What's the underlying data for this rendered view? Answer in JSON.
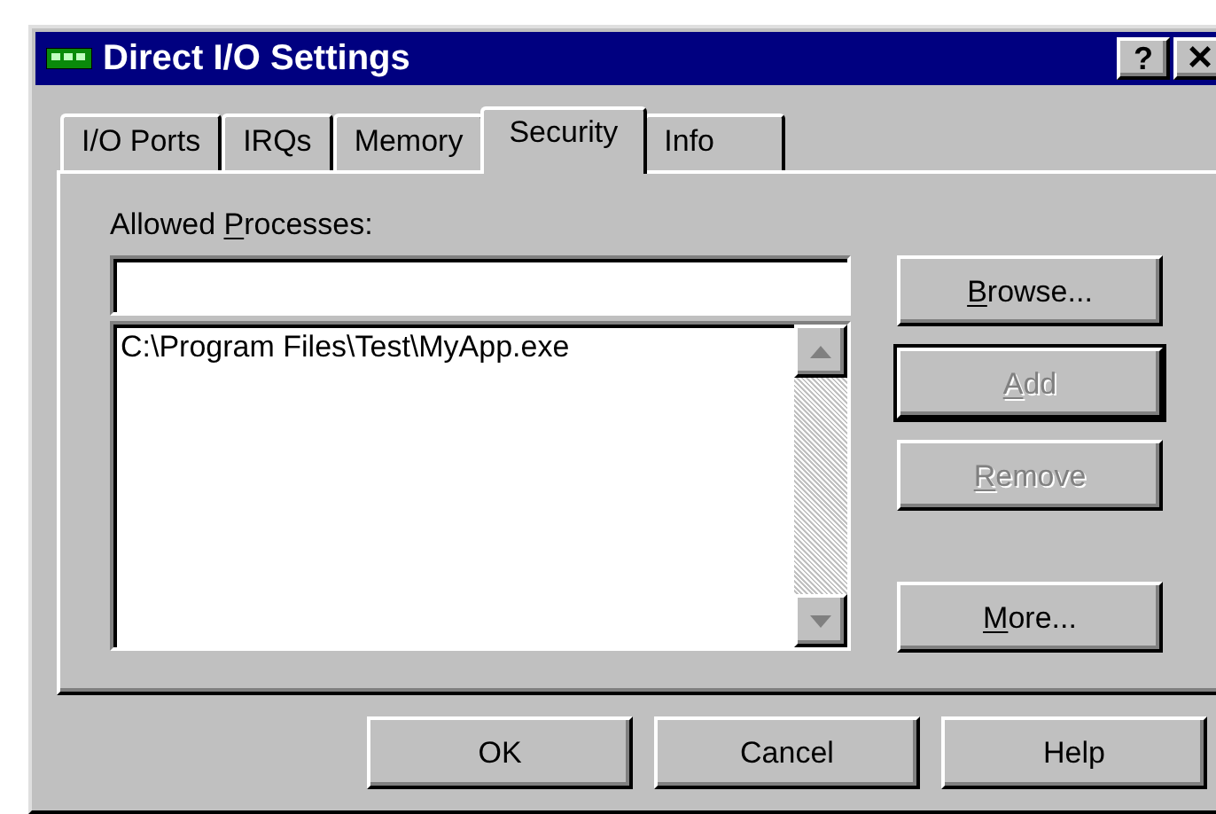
{
  "window": {
    "title": "Direct I/O Settings"
  },
  "title_buttons": [
    {
      "kind": "help",
      "label": "?"
    },
    {
      "kind": "close",
      "label": "×"
    }
  ],
  "tabs": [
    {
      "label": "I/O Ports",
      "selected": false
    },
    {
      "label": "IRQs",
      "selected": false
    },
    {
      "label": "Memory",
      "selected": false
    },
    {
      "label": "Security",
      "selected": true
    },
    {
      "label": "Info",
      "selected": false
    }
  ],
  "allowed_processes": {
    "label": "Allowed Processes:",
    "mnemonic": true,
    "items": [
      "C:\\Program Files\\Test\\MyApp.exe"
    ]
  },
  "side_buttons": [
    {
      "label": "Browse...",
      "mnemonic": true,
      "disabled": false,
      "default": false
    },
    {
      "label": "Add",
      "mnemonic": true,
      "disabled": true,
      "default": true
    },
    {
      "label": "Remove",
      "mnemonic": true,
      "disabled": true,
      "default": false
    },
    {
      "label": "More...",
      "mnemonic": true,
      "disabled": false,
      "default": false
    }
  ],
  "buttons": [
    "OK",
    "Cancel",
    "Help"
  ]
}
